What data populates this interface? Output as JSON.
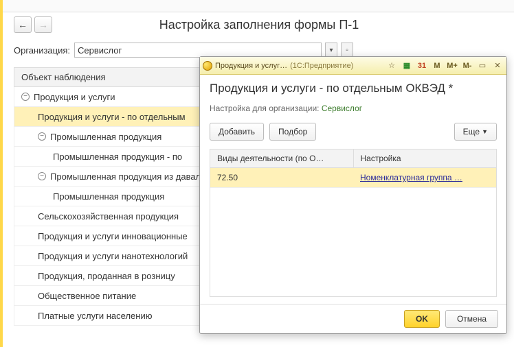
{
  "page": {
    "title": "Настройка заполнения формы П-1"
  },
  "org": {
    "label": "Организация:",
    "value": "Сервислог"
  },
  "tree": {
    "header": "Объект наблюдения",
    "rows": [
      {
        "label": "Продукция и услуги",
        "level": 0,
        "expander": "−",
        "selected": false
      },
      {
        "label": "Продукция и услуги - по отдельным",
        "level": 1,
        "expander": "",
        "selected": true
      },
      {
        "label": "Промышленная продукция",
        "level": 1,
        "expander": "−",
        "selected": false
      },
      {
        "label": "Промышленная продукция - по",
        "level": 2,
        "expander": "",
        "selected": false
      },
      {
        "label": "Промышленная продукция из давальческого",
        "level": 1,
        "expander": "−",
        "selected": false
      },
      {
        "label": "Промышленная продукция",
        "level": 2,
        "expander": "",
        "selected": false
      },
      {
        "label": "Сельскохозяйственная продукция",
        "level": 1,
        "expander": "",
        "selected": false
      },
      {
        "label": "Продукция и услуги инновационные",
        "level": 1,
        "expander": "",
        "selected": false
      },
      {
        "label": "Продукция и услуги нанотехнологий",
        "level": 1,
        "expander": "",
        "selected": false
      },
      {
        "label": "Продукция, проданная в розницу",
        "level": 1,
        "expander": "",
        "selected": false
      },
      {
        "label": "Общественное питание",
        "level": 1,
        "expander": "",
        "selected": false
      },
      {
        "label": "Платные услуги населению",
        "level": 1,
        "expander": "",
        "selected": false
      }
    ]
  },
  "modal": {
    "titlebar": {
      "text": "Продукция и услуг…",
      "subtext": "(1С:Предприятие)",
      "m_buttons": [
        "M",
        "M+",
        "M-"
      ]
    },
    "heading": "Продукция и услуги - по отдельным ОКВЭД *",
    "sub_label": "Настройка для организации:",
    "sub_value": "Сервислог",
    "buttons": {
      "add": "Добавить",
      "pick": "Подбор",
      "more": "Еще"
    },
    "table": {
      "col1": "Виды деятельности (по О…",
      "col2": "Настройка",
      "rows": [
        {
          "v1": "72.50",
          "v2": "Номенклатурная группа …"
        }
      ]
    },
    "footer": {
      "ok": "OK",
      "cancel": "Отмена"
    }
  }
}
